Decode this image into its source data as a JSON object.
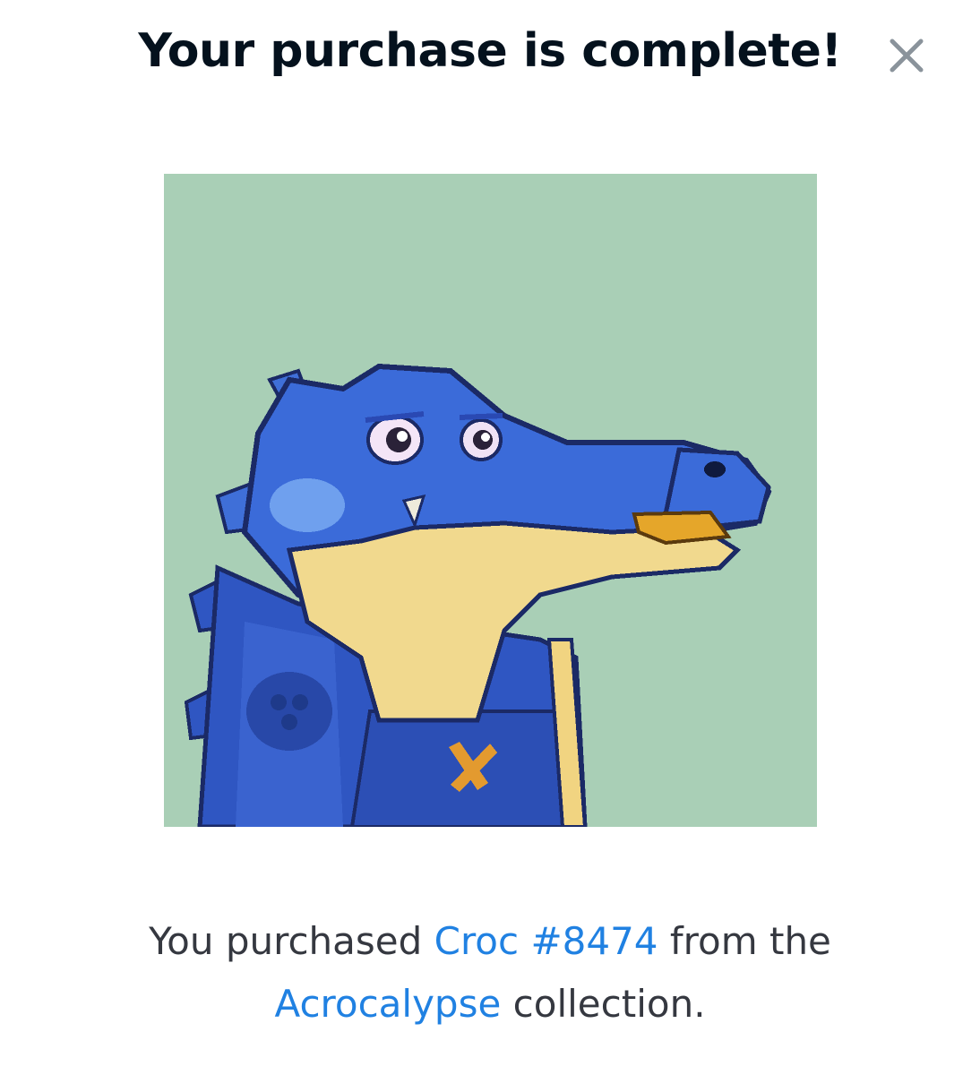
{
  "modal": {
    "title": "Your purchase is complete!",
    "close_icon": "close-icon"
  },
  "nft": {
    "image_icon": "pixel-art-crocodile",
    "background_color": "#a9cfb6"
  },
  "message": {
    "prefix": "You purchased ",
    "item_name": "Croc #8474",
    "middle": " from the",
    "collection_name": "Acrocalypse",
    "suffix": " collection."
  },
  "colors": {
    "title": "#04111d",
    "body_text": "#353840",
    "link": "#2081e2",
    "close_icon": "#8a939b"
  }
}
